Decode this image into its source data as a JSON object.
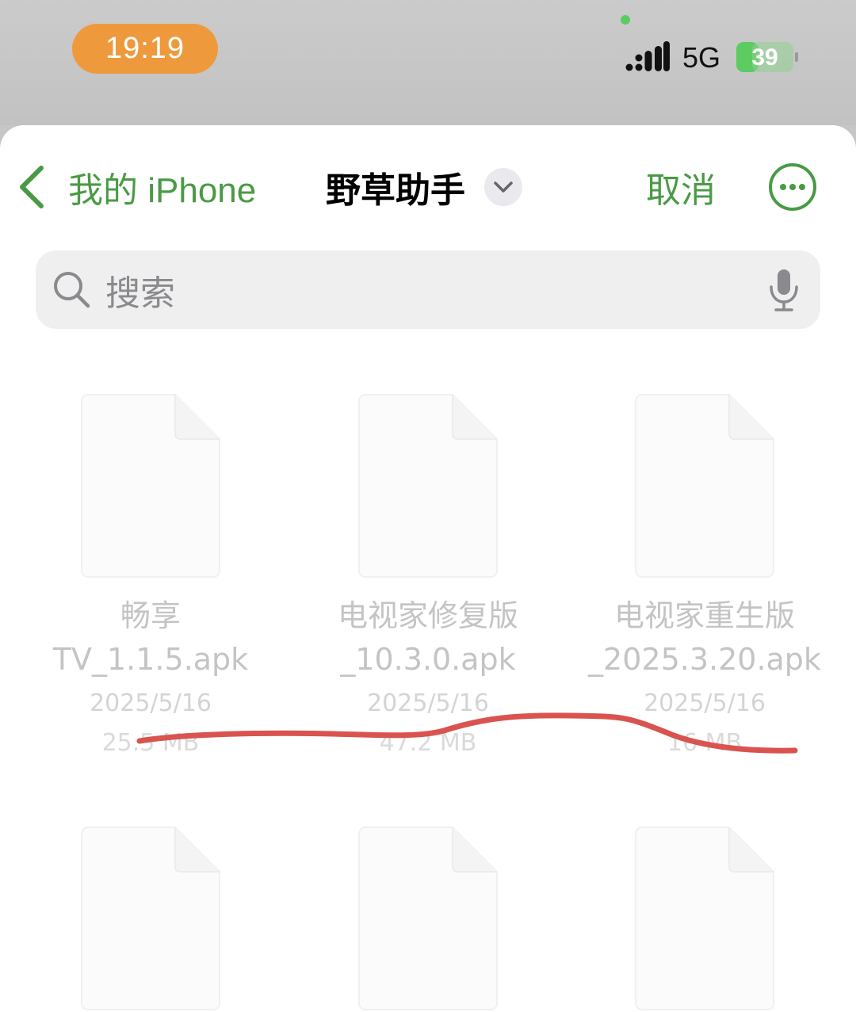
{
  "status_bar": {
    "time": "19:19",
    "network": "5G",
    "battery": "39",
    "time_pill_color": "#ee9a3c",
    "indicator_color": "#5ccb62",
    "battery_color": "#5ccb62"
  },
  "nav": {
    "back_label": "我的 iPhone",
    "title": "野草助手",
    "cancel_label": "取消",
    "accent_color": "#4a9a45"
  },
  "search": {
    "placeholder": "搜索"
  },
  "files": [
    {
      "name_line1": "畅享",
      "name_line2": "TV_1.1.5.apk",
      "date": "2025/5/16",
      "size": "25.5 MB"
    },
    {
      "name_line1": "电视家修复版",
      "name_line2": "_10.3.0.apk",
      "date": "2025/5/16",
      "size": "47.2 MB"
    },
    {
      "name_line1": "电视家重生版",
      "name_line2": "_2025.3.20.apk",
      "date": "2025/5/16",
      "size": "16 MB"
    },
    {
      "name_line1": "",
      "name_line2": "",
      "date": "",
      "size": ""
    },
    {
      "name_line1": "",
      "name_line2": "",
      "date": "",
      "size": ""
    },
    {
      "name_line1": "",
      "name_line2": "",
      "date": "",
      "size": ""
    }
  ],
  "annotation": {
    "stroke_color": "#d9534f"
  }
}
